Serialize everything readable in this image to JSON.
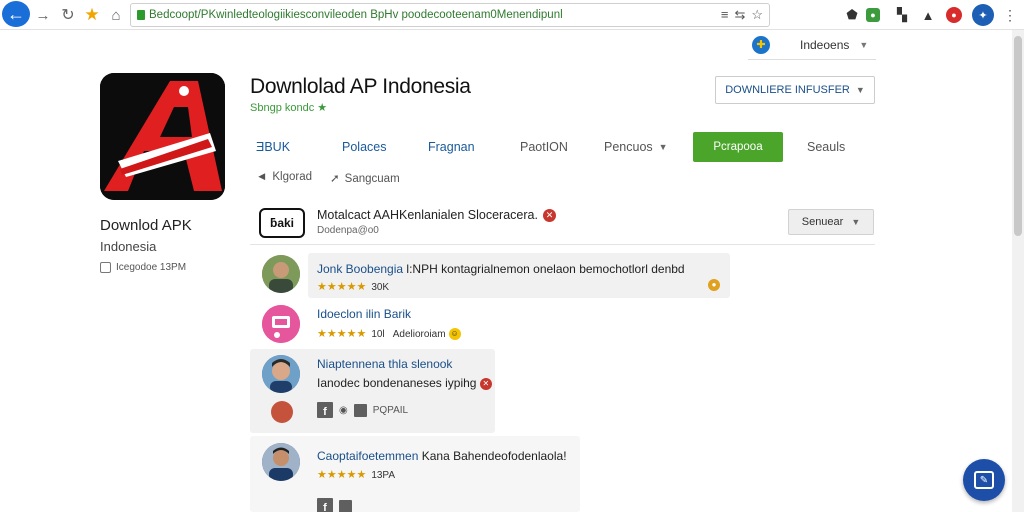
{
  "browser": {
    "url": "Bedcoopt/PKwinledteologiikiesconvileoden BpHv poodecooteenam0Menendipunl",
    "url_icons": [
      "≡",
      "⇆",
      "☆"
    ]
  },
  "locale": {
    "label": "Indeoens"
  },
  "app": {
    "title": "Downlolad AP Indonesia",
    "subtitle": "Sbngp kondc",
    "name": "Downlod APK",
    "region": "Indonesia",
    "meta": "Icegodoe 13PM"
  },
  "download_select": {
    "label": "DOWNLIERE INFUSFER"
  },
  "tabs": [
    {
      "label": "ƎBUK"
    },
    {
      "label": "Polaces"
    },
    {
      "label": "Fragnan"
    },
    {
      "label": "PaotION"
    },
    {
      "label": "Pencuos"
    },
    {
      "label": "Pcrapooa"
    },
    {
      "label": "Seauls"
    }
  ],
  "subnav": [
    {
      "icon": "◄",
      "label": "Klgorad"
    },
    {
      "icon": "➚",
      "label": "Sangcuam"
    }
  ],
  "notice": {
    "logo_text": "ƃaki",
    "text": "Motalcact AAHKenlanialen Sloceracera.",
    "sub": "Dodenpa@o0",
    "button_label": "Senuear"
  },
  "reviews": [
    {
      "name": "Jonk Boobengia",
      "body": "l:NPH kontagrialnemon onelaon bemochotlorl denbd",
      "rating": "★★★★★",
      "count": "30K",
      "badge": "●"
    },
    {
      "name": "Idoeclon ilin Barik",
      "body": "",
      "rating": "★★★★★",
      "count": "10l",
      "extra": "Adelioroiam",
      "badge": "☺"
    },
    {
      "name": "Niaptennena thla slenook",
      "body": "Ianodec  bondenaneses iypihg",
      "share": "PQPAIL",
      "badge": "✕"
    },
    {
      "name": "Caoptaifoetemmen",
      "body": "Kana Bahendeofodenlaola!",
      "rating": "★★★★★",
      "count": "13PA"
    }
  ],
  "colors": {
    "accent_blue": "#1a5a9a",
    "green": "#4aa52a",
    "rating": "#d99a00"
  }
}
